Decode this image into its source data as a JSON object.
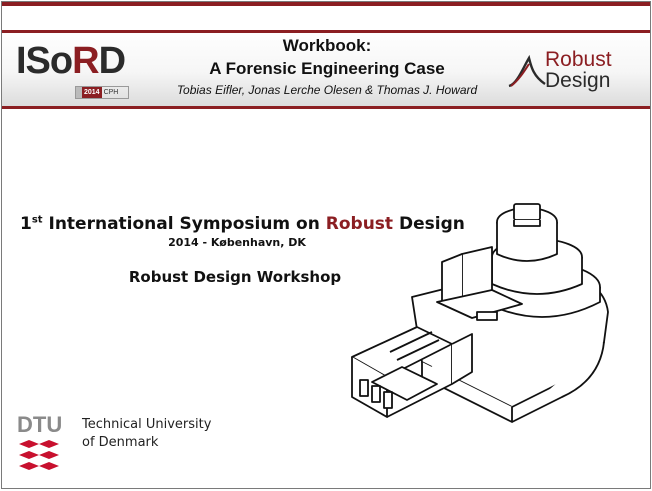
{
  "header": {
    "logo_left": {
      "prefix": "ISo",
      "accent": "R",
      "suffix": "D",
      "badge_year": "2014",
      "badge_city": "CPH"
    },
    "title_line1": "Workbook:",
    "title_line2": "A Forensic Engineering Case",
    "authors": "Tobias Eifler, Jonas Lerche Olesen & Thomas J. Howard",
    "logo_right": {
      "line1": "Robust",
      "line2": "Design"
    }
  },
  "body": {
    "symposium": {
      "ordinal_num": "1",
      "ordinal_sup": "st",
      "pre": " International Symposium on ",
      "accent": "Robust",
      "post": " Design"
    },
    "subtitle": "2014 - København, DK",
    "workshop": "Robust Design Workshop"
  },
  "footer": {
    "university_line1": "Technical University",
    "university_line2": "of Denmark"
  },
  "colors": {
    "accent": "#8b1e22",
    "text": "#111111",
    "header_gradient_end": "#dcdcdc"
  }
}
